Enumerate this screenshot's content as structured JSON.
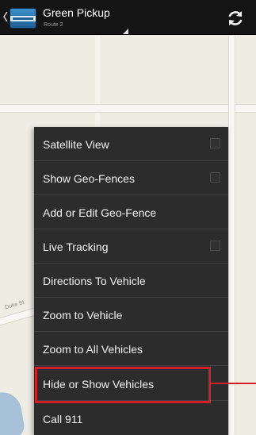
{
  "action_bar": {
    "title": "Green Pickup",
    "subtitle": "Route 2",
    "app_icon": "app-logo-icon",
    "up_icon": "chevron-left-icon",
    "refresh_icon": "refresh-icon"
  },
  "map": {
    "road_label": "Duke St"
  },
  "menu": {
    "items": [
      {
        "label": "Satellite View",
        "checkbox": true,
        "checked": false
      },
      {
        "label": "Show Geo-Fences",
        "checkbox": true,
        "checked": false
      },
      {
        "label": "Add or Edit Geo-Fence",
        "checkbox": false
      },
      {
        "label": "Live Tracking",
        "checkbox": true,
        "checked": false
      },
      {
        "label": "Directions To Vehicle",
        "checkbox": false
      },
      {
        "label": "Zoom to Vehicle",
        "checkbox": false
      },
      {
        "label": "Zoom to All Vehicles",
        "checkbox": false
      },
      {
        "label": "Hide or Show Vehicles",
        "checkbox": false,
        "highlighted": true
      },
      {
        "label": "Call 911",
        "checkbox": false
      }
    ]
  },
  "colors": {
    "action_bar_bg": "#141414",
    "menu_bg": "#2c2c2c",
    "highlight": "#d11f27",
    "map_bg": "#efece4"
  }
}
